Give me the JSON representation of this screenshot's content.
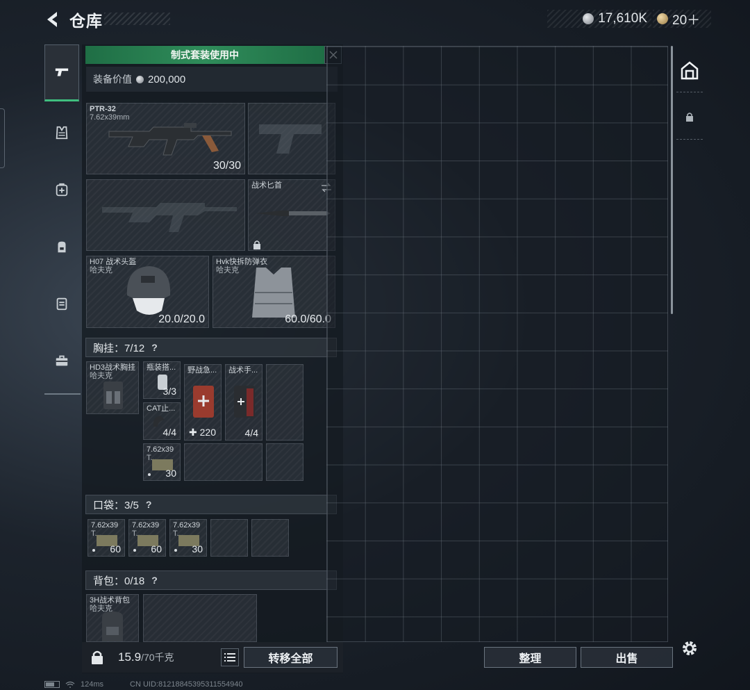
{
  "header": {
    "title": "仓库",
    "currency_silver": "17,610K",
    "currency_gold": "20＋"
  },
  "side_nav": {
    "items": [
      {
        "icon": "pistol-icon",
        "active": true
      },
      {
        "icon": "vest-icon",
        "active": false
      },
      {
        "icon": "medkit-bag-icon",
        "active": false
      },
      {
        "icon": "backpack-icon",
        "active": false
      },
      {
        "icon": "container-icon",
        "active": false
      },
      {
        "icon": "toolbox-icon",
        "active": false
      }
    ]
  },
  "loadout": {
    "banner": "制式套装使用中",
    "value_label": "装备价值",
    "value": "200,000",
    "primary_weapon": {
      "name": "PTR-32",
      "caliber": "7.62x39mm",
      "ammo": "30/30"
    },
    "melee": {
      "name": "战术匕首"
    },
    "helmet": {
      "name": "H07 战术头盔",
      "brand": "哈夫克",
      "durability": "20.0/20.0"
    },
    "armor": {
      "name": "Hvk快拆防弹衣",
      "brand": "哈夫克",
      "durability": "60.0/60.0"
    },
    "chest_rig": {
      "label": "胸挂：7/12",
      "help": "?",
      "rig": {
        "name": "HD3战术胸挂",
        "brand": "哈夫克"
      },
      "items": [
        {
          "name": "瓶装搭...",
          "qty": "3/3"
        },
        {
          "name": "野战急...",
          "qty": "220"
        },
        {
          "name": "战术手...",
          "qty": "4/4"
        },
        {
          "name": "CAT止...",
          "qty": "4/4"
        },
        {
          "name": "7.62x39",
          "sub": "T...",
          "qty": "30"
        }
      ]
    },
    "pockets": {
      "label": "口袋：3/5",
      "help": "?",
      "items": [
        {
          "name": "7.62x39",
          "sub": "T...",
          "qty": "60"
        },
        {
          "name": "7.62x39",
          "sub": "T...",
          "qty": "60"
        },
        {
          "name": "7.62x39",
          "sub": "T...",
          "qty": "30"
        }
      ]
    },
    "backpack": {
      "label": "背包：0/18",
      "help": "?",
      "bag": {
        "name": "3H战术背包",
        "brand": "哈夫克"
      }
    }
  },
  "bottom": {
    "weight": "15.9",
    "weight_cap": "/70千克",
    "transfer_all": "转移全部",
    "sort": "整理",
    "sell": "出售"
  },
  "status": {
    "ping": "124ms",
    "uid": "CN UID:81218845395311554940"
  },
  "colors": {
    "accent_green": "#2f8c5a",
    "background": "#1c232c"
  }
}
